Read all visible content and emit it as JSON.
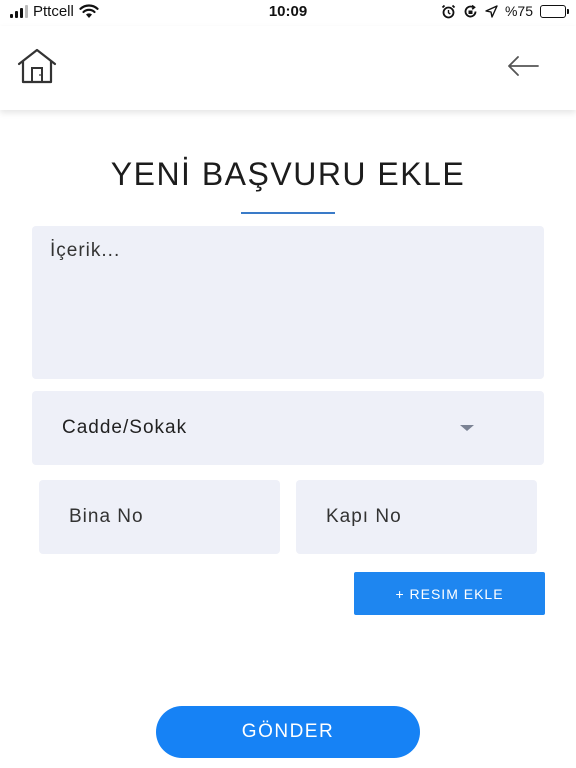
{
  "status_bar": {
    "carrier": "Pttcell",
    "time": "10:09",
    "battery_label": "%75",
    "icons": [
      "signal-icon",
      "wifi-icon",
      "alarm-icon",
      "orientation-lock-icon",
      "location-icon",
      "battery-icon"
    ]
  },
  "header": {
    "home_icon": "home-icon",
    "back_icon": "arrow-left-icon"
  },
  "page": {
    "title": "YENİ BAŞVURU EKLE"
  },
  "form": {
    "content_placeholder": "İçerik...",
    "street_select_value": "Cadde/Sokak",
    "building_no_placeholder": "Bina No",
    "door_no_placeholder": "Kapı No",
    "add_image_label": "+ RESIM EKLE",
    "submit_label": "GÖNDER"
  },
  "colors": {
    "accent_blue": "#1682f5",
    "field_background": "#eef0f8",
    "title_underline": "#3a7bc8"
  }
}
